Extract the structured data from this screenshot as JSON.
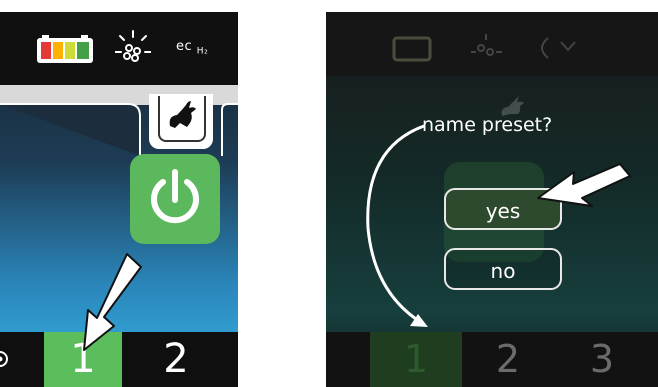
{
  "left_panel": {
    "status_icons": [
      "battery-icon",
      "sunlight-icon",
      "ech2-icon"
    ],
    "battery_colors": [
      "#e53935",
      "#ffb300",
      "#cddc39",
      "#43a047"
    ],
    "ech2_text": "ec",
    "ech2_sub": "H₂",
    "mode_tab_icon": "rabbit-icon",
    "power_icon": "power-icon",
    "power_color": "#5bb85c",
    "presets": [
      {
        "label": "1",
        "selected": true,
        "color": "#5bbd5c"
      },
      {
        "label": "2",
        "selected": false
      }
    ],
    "callout": "arrow-pointing-to-preset-1"
  },
  "right_panel": {
    "prompt": "name preset?",
    "options": [
      {
        "label": "yes",
        "highlighted": true
      },
      {
        "label": "no",
        "highlighted": false
      }
    ],
    "presets": [
      "1",
      "2",
      "3"
    ],
    "callout": "arrow-pointing-to-yes"
  }
}
